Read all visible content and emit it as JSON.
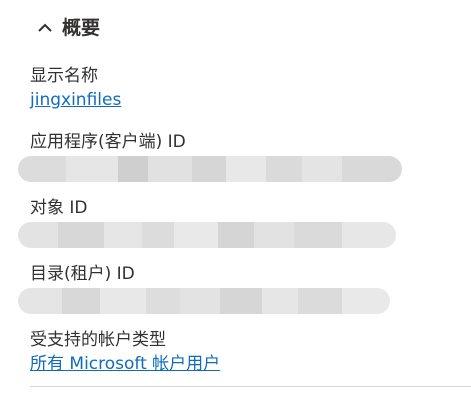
{
  "section": {
    "title": "概要",
    "icon": "chevron-up-icon"
  },
  "fields": {
    "display_name": {
      "label": "显示名称",
      "value": "jingxinfiles"
    },
    "app_client_id": {
      "label": "应用程序(客户端) ID"
    },
    "object_id": {
      "label": "对象 ID"
    },
    "directory_tenant_id": {
      "label": "目录(租户) ID"
    },
    "supported_account_types": {
      "label": "受支持的帐户类型",
      "value": "所有 Microsoft 帐户用户"
    }
  },
  "colors": {
    "link": "#0f6cbd",
    "text": "#323130",
    "divider": "#d8d8d8"
  }
}
